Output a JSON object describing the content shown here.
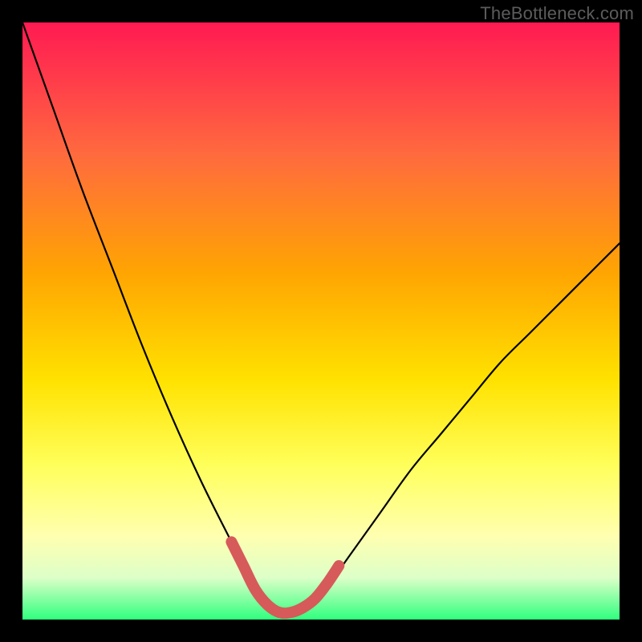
{
  "watermark": "TheBottleneck.com",
  "colors": {
    "curve_stroke": "#000000",
    "highlight_stroke": "#d65a5a",
    "background_black": "#000000"
  },
  "chart_data": {
    "type": "line",
    "title": "",
    "xlabel": "",
    "ylabel": "",
    "xlim": [
      0,
      100
    ],
    "ylim": [
      0,
      100
    ],
    "series": [
      {
        "name": "bottleneck-curve",
        "x": [
          0,
          5,
          10,
          15,
          20,
          25,
          30,
          35,
          38,
          40,
          42,
          44,
          46,
          48,
          50,
          55,
          60,
          65,
          70,
          75,
          80,
          85,
          90,
          95,
          100
        ],
        "y": [
          100,
          86,
          72,
          59,
          46,
          34,
          23,
          13,
          7,
          4,
          2,
          1,
          1,
          2,
          4,
          11,
          18,
          25,
          31,
          37,
          43,
          48,
          53,
          58,
          63
        ]
      }
    ],
    "highlight": {
      "name": "optimal-range",
      "x": [
        35,
        37,
        39,
        41,
        43,
        45,
        47,
        49,
        51,
        53
      ],
      "y": [
        13,
        9,
        5,
        2.5,
        1.2,
        1.2,
        2,
        3.5,
        6,
        9
      ]
    }
  }
}
